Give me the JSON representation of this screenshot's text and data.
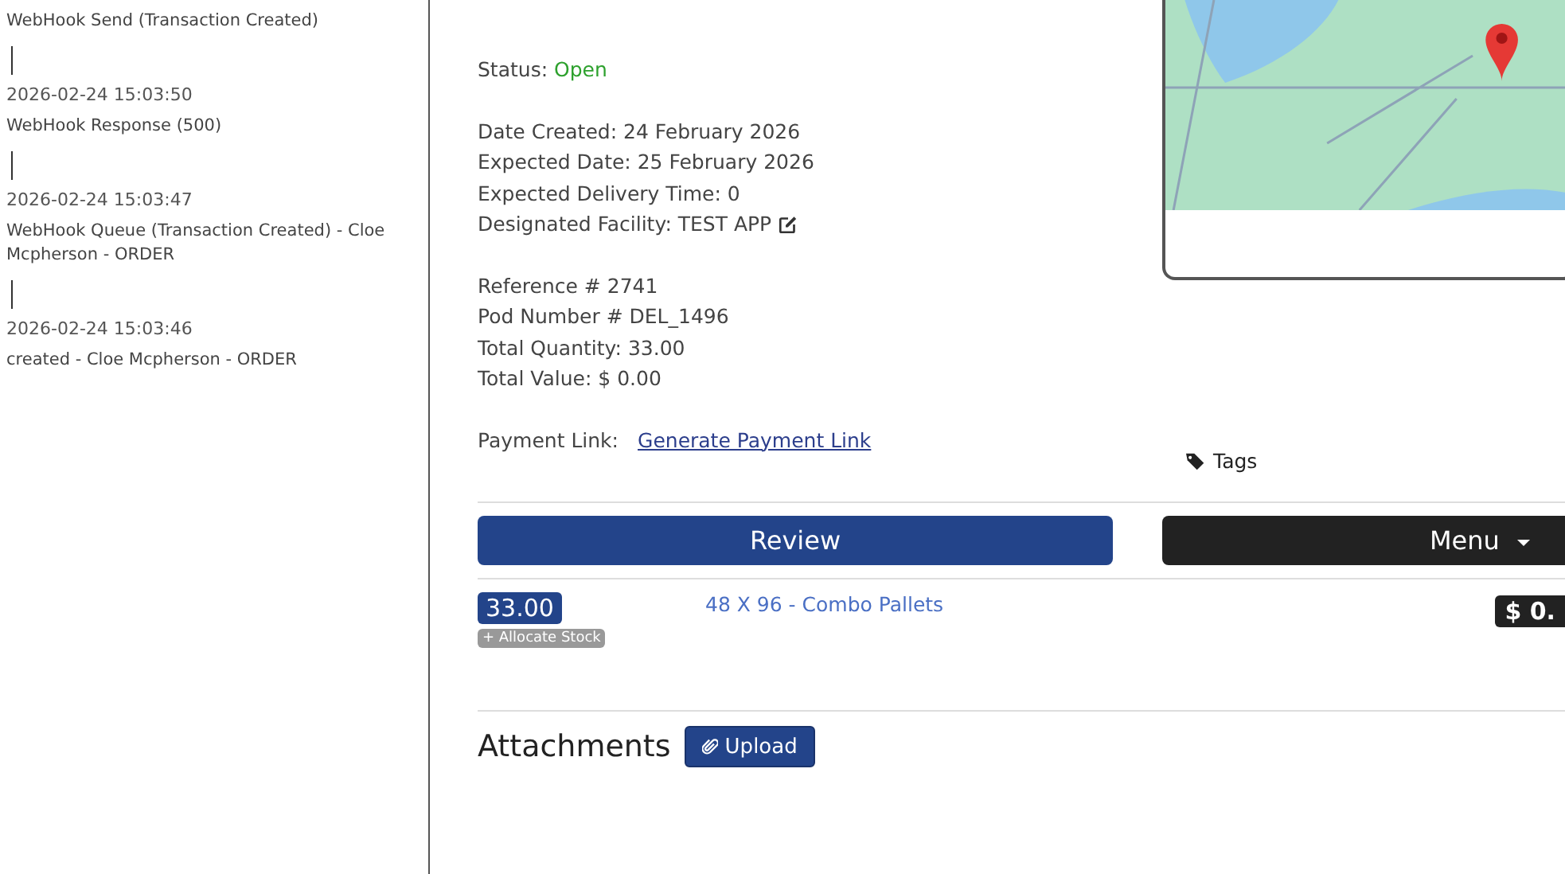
{
  "timeline": [
    {
      "text": "WebHook Send (Transaction Created)"
    },
    {
      "time": "2026-02-24 15:03:50",
      "text": "WebHook Response (500)"
    },
    {
      "time": "2026-02-24 15:03:47",
      "text": "WebHook Queue (Transaction Created) - Cloe Mcpherson - ORDER"
    },
    {
      "time": "2026-02-24 15:03:46",
      "text": "created - Cloe Mcpherson - ORDER"
    }
  ],
  "status": {
    "label": "Status:",
    "value": "Open"
  },
  "dates": [
    {
      "label": "Date Created:",
      "value": "24 February 2026"
    },
    {
      "label": "Expected Date:",
      "value": "25 February 2026"
    },
    {
      "label": "Expected Delivery Time:",
      "value": "0"
    },
    {
      "label": "Designated Facility:",
      "value": "TEST APP",
      "editable": true
    }
  ],
  "totals": [
    {
      "label": "Reference #",
      "value": "2741"
    },
    {
      "label": "Pod Number #",
      "value": "DEL_1496"
    },
    {
      "label": "Total Quantity:",
      "value": "33.00"
    },
    {
      "label": "Total Value:",
      "value": "$ 0.00"
    }
  ],
  "payment": {
    "label": "Payment Link:",
    "link": "Generate Payment Link"
  },
  "tags": {
    "label": "Tags"
  },
  "buttons": {
    "review": "Review",
    "menu": "Menu"
  },
  "line_item": {
    "quantity": "33.00",
    "allocate": "+ Allocate Stock",
    "product": "48 X 96 - Combo Pallets",
    "price": "$ 0."
  },
  "attachments": {
    "title": "Attachments",
    "upload": "Upload"
  }
}
